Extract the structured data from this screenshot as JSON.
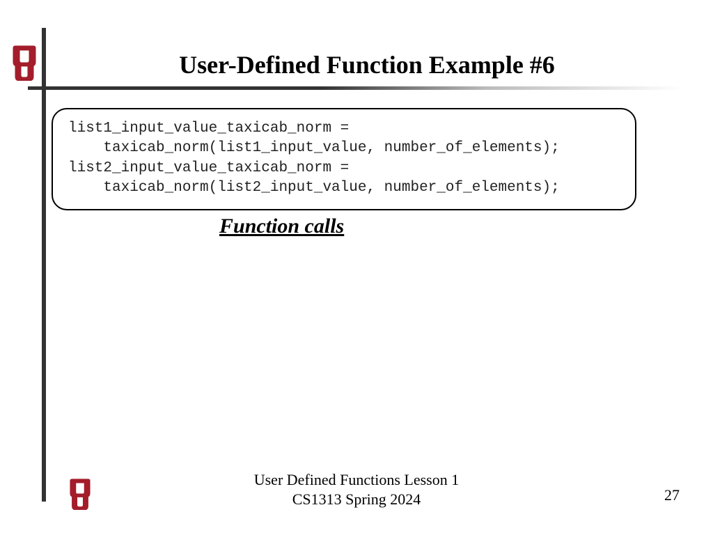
{
  "title": "User-Defined Function Example #6",
  "code": "list1_input_value_taxicab_norm =\n    taxicab_norm(list1_input_value, number_of_elements);\nlist2_input_value_taxicab_norm =\n    taxicab_norm(list2_input_value, number_of_elements);",
  "subtitle": "Function calls",
  "footer": {
    "line1": "User Defined Functions Lesson 1",
    "line2": "CS1313 Spring 2024"
  },
  "page_number": "27",
  "logo": {
    "name": "ou-logo",
    "color": "#a31d2a"
  }
}
